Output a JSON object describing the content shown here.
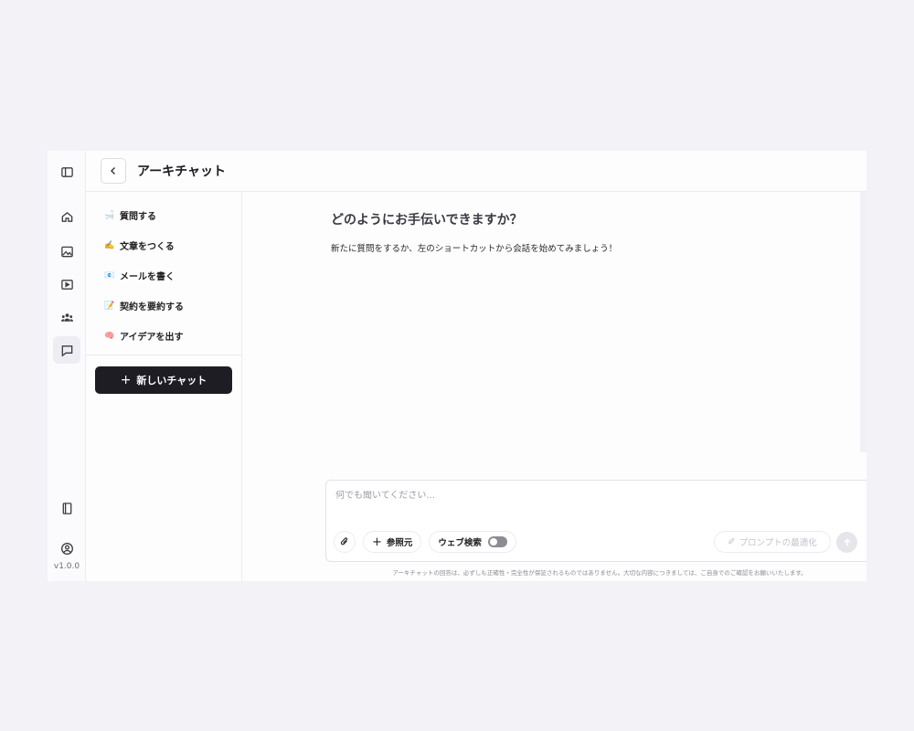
{
  "app": {
    "title": "アーキチャット",
    "version": "v1.0.0"
  },
  "rail": {
    "items": [
      {
        "icon": "sidebar-toggle-icon"
      },
      {
        "icon": "home-icon"
      },
      {
        "icon": "image-icon"
      },
      {
        "icon": "video-icon"
      },
      {
        "icon": "users-icon"
      },
      {
        "icon": "chat-icon",
        "active": true
      },
      {
        "icon": "book-icon"
      },
      {
        "icon": "user-circle-icon"
      }
    ]
  },
  "shortcuts": [
    {
      "emoji": "🛁",
      "label": "質問する"
    },
    {
      "emoji": "✍️",
      "label": "文章をつくる"
    },
    {
      "emoji": "📧",
      "label": "メールを書く"
    },
    {
      "emoji": "📝",
      "label": "契約を要約する"
    },
    {
      "emoji": "🧠",
      "label": "アイデアを出す"
    }
  ],
  "new_chat": {
    "plus": "+",
    "label": "新しいチャット"
  },
  "chat": {
    "greeting": "どのようにお手伝いできますか？",
    "subtitle": "新たに質問をするか、左のショートカットから会話を始めてみましょう！"
  },
  "composer": {
    "placeholder": "何でも聞いてください...",
    "reference_plus": "+",
    "reference_label": "参照元",
    "web_search_label": "ウェブ検索",
    "web_search_enabled": false,
    "optimize_label": "プロンプトの最適化"
  },
  "disclaimer": "アーキチャットの回答は、必ずしも正確性・完全性が保証されるものではありません。大切な内容につきましては、ご自身でのご確認をお願いいたします。",
  "colors": {
    "accent_dark": "#1f1d24",
    "background": "#f3f2f7"
  }
}
